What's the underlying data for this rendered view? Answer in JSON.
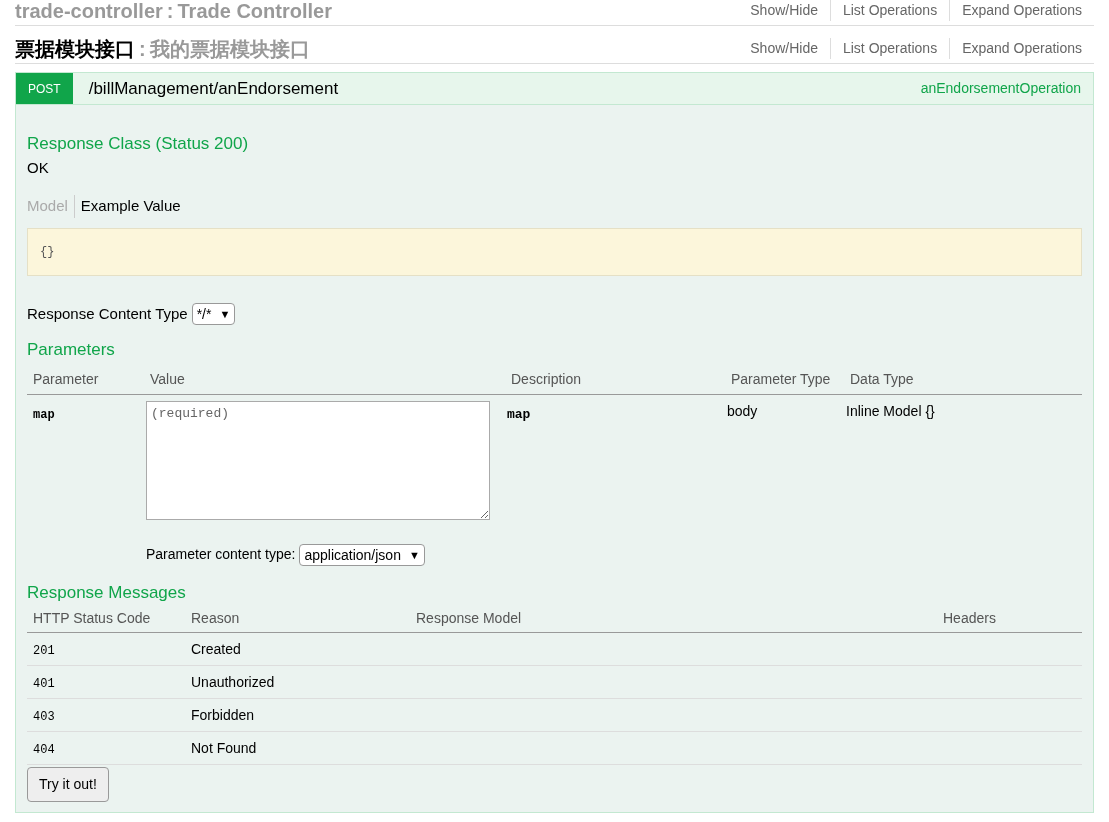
{
  "sections": [
    {
      "name": "trade-controller",
      "separator": ":",
      "description": "Trade Controller",
      "actions": [
        "Show/Hide",
        "List Operations",
        "Expand Operations"
      ]
    },
    {
      "name": "票据模块接口",
      "separator": ":",
      "description": "我的票据模块接口",
      "actions": [
        "Show/Hide",
        "List Operations",
        "Expand Operations"
      ]
    }
  ],
  "operation": {
    "method": "POST",
    "path": "/billManagement/anEndorsement",
    "nickname": "anEndorsementOperation",
    "response_class": {
      "heading": "Response Class (Status 200)",
      "text": "OK",
      "tabs": [
        {
          "label": "Model",
          "selected": false
        },
        {
          "label": "Example Value",
          "selected": true
        }
      ],
      "example": "{}"
    },
    "response_content_type": {
      "label": "Response Content Type",
      "value": "*/*",
      "caret": "▼"
    },
    "parameters": {
      "heading": "Parameters",
      "columns": [
        "Parameter",
        "Value",
        "Description",
        "Parameter Type",
        "Data Type"
      ],
      "rows": [
        {
          "name": "map",
          "placeholder": "(required)",
          "description": "map",
          "param_type": "body",
          "data_type": "Inline Model {}",
          "content_type": {
            "label": "Parameter content type:",
            "value": "application/json",
            "caret": "▼"
          }
        }
      ]
    },
    "response_messages": {
      "heading": "Response Messages",
      "columns": [
        "HTTP Status Code",
        "Reason",
        "Response Model",
        "Headers"
      ],
      "rows": [
        {
          "code": "201",
          "reason": "Created"
        },
        {
          "code": "401",
          "reason": "Unauthorized"
        },
        {
          "code": "403",
          "reason": "Forbidden"
        },
        {
          "code": "404",
          "reason": "Not Found"
        }
      ]
    },
    "submit": "Try it out!"
  }
}
